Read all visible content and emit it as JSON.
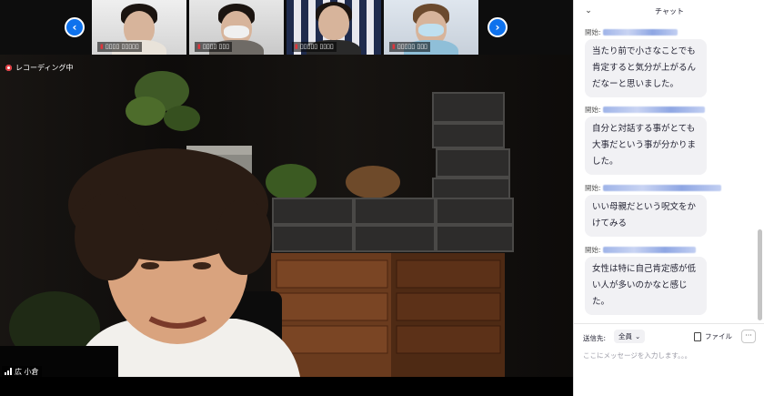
{
  "participants": [
    {
      "name_blurred": true,
      "tile": "participant-1"
    },
    {
      "name_blurred": true,
      "tile": "participant-2"
    },
    {
      "name_blurred": true,
      "tile": "participant-3"
    },
    {
      "name_blurred": true,
      "tile": "participant-4"
    }
  ],
  "nav": {
    "prev_icon": "‹",
    "next_icon": "›"
  },
  "recording": {
    "label": "レコーディング中"
  },
  "speaker": {
    "name": "広 小倉"
  },
  "chat": {
    "title": "チャット",
    "collapse_icon": "⌄",
    "messages": [
      {
        "sender_prefix": "開始:",
        "text": "当たり前で小さなことでも肯定すると気分が上がるんだなーと思いました。"
      },
      {
        "sender_prefix": "開始:",
        "text": "自分と対話する事がとても大事だという事が分かりました。"
      },
      {
        "sender_prefix": "開始:",
        "text": "いい母親だという呪文をかけてみる"
      },
      {
        "sender_prefix": "開始:",
        "text": "女性は特に自己肯定感が低い人が多いのかなと感じた。"
      }
    ],
    "send_to_label": "送信先:",
    "recipient": "全員",
    "recipient_icon": "⌄",
    "file_label": "ファイル",
    "more_label": "···",
    "input_placeholder": "ここにメッセージを入力します。。。"
  },
  "colors": {
    "accent": "#0e72ed",
    "recording_red": "#e0353b",
    "bubble": "#f1f1f4"
  }
}
